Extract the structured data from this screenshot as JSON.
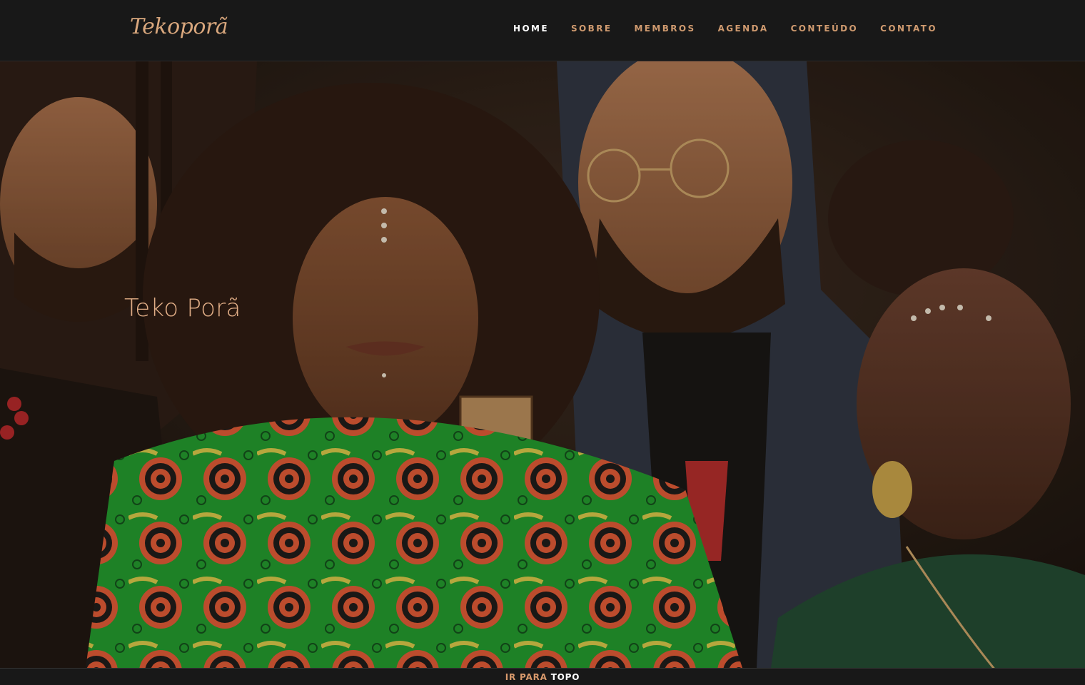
{
  "header": {
    "logo_text": "Tekoporã",
    "nav": [
      {
        "label": "HOME",
        "active": true
      },
      {
        "label": "SOBRE",
        "active": false
      },
      {
        "label": "MEMBROS",
        "active": false
      },
      {
        "label": "AGENDA",
        "active": false
      },
      {
        "label": "CONTEÚDO",
        "active": false
      },
      {
        "label": "CONTATO",
        "active": false
      }
    ]
  },
  "hero": {
    "title": "Teko Porã"
  },
  "footer": {
    "back_to_top_part1": "IR PARA",
    "back_to_top_part2": "TOPO"
  },
  "colors": {
    "accent": "#cf9a6f",
    "header_bg": "#181818",
    "active_nav": "#ffffff"
  }
}
